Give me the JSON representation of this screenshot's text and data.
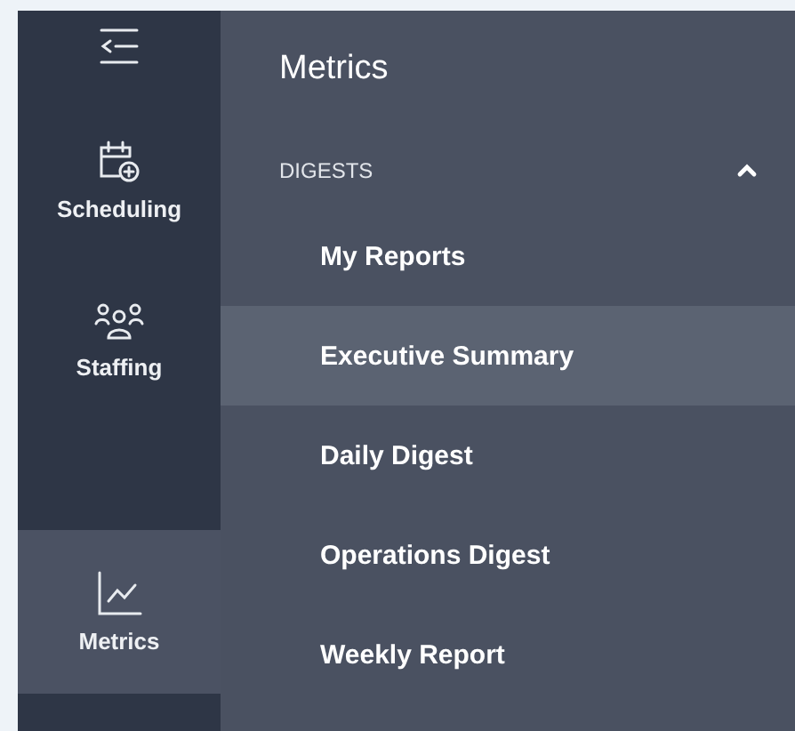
{
  "rail": {
    "items": [
      {
        "kind": "calendar",
        "label": "Scheduling",
        "selected": false
      },
      {
        "kind": "people",
        "label": "Staffing",
        "selected": false
      },
      {
        "kind": "chart",
        "label": "Metrics",
        "selected": true
      }
    ]
  },
  "panel": {
    "title": "Metrics",
    "section": {
      "label": "DIGESTS",
      "expanded": true
    },
    "items": [
      {
        "label": "My Reports",
        "selected": false
      },
      {
        "label": "Executive Summary",
        "selected": true
      },
      {
        "label": "Daily Digest",
        "selected": false
      },
      {
        "label": "Operations Digest",
        "selected": false
      },
      {
        "label": "Weekly Report",
        "selected": false
      }
    ]
  }
}
